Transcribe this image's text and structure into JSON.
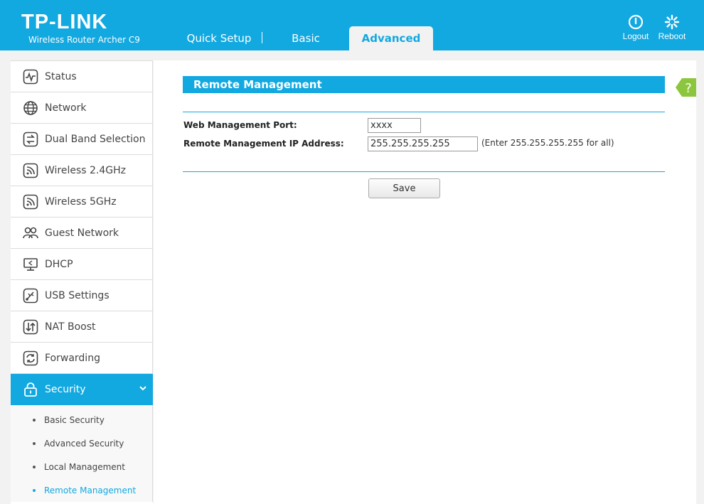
{
  "header": {
    "brand": "TP-LINK",
    "model": "Wireless Router Archer C9",
    "tabs": [
      {
        "label": "Quick Setup"
      },
      {
        "label": "Basic"
      },
      {
        "label": "Advanced"
      }
    ],
    "logout_label": "Logout",
    "reboot_label": "Reboot"
  },
  "sidebar": {
    "items": [
      {
        "label": "Status",
        "icon": "status-icon"
      },
      {
        "label": "Network",
        "icon": "globe-icon"
      },
      {
        "label": "Dual Band Selection",
        "icon": "dual-band-icon"
      },
      {
        "label": "Wireless 2.4GHz",
        "icon": "wireless-icon"
      },
      {
        "label": "Wireless 5GHz",
        "icon": "wireless-icon"
      },
      {
        "label": "Guest Network",
        "icon": "guest-icon"
      },
      {
        "label": "DHCP",
        "icon": "monitor-icon"
      },
      {
        "label": "USB Settings",
        "icon": "usb-icon"
      },
      {
        "label": "NAT Boost",
        "icon": "nat-icon"
      },
      {
        "label": "Forwarding",
        "icon": "forwarding-icon"
      },
      {
        "label": "Security",
        "icon": "lock-icon"
      }
    ],
    "security_sub": [
      {
        "label": "Basic Security"
      },
      {
        "label": "Advanced Security"
      },
      {
        "label": "Local Management"
      },
      {
        "label": "Remote Management"
      }
    ]
  },
  "main": {
    "title": "Remote Management",
    "help_label": "?",
    "port_label": "Web Management Port:",
    "port_value": "xxxx",
    "ip_label": "Remote Management IP Address:",
    "ip_value": "255.255.255.255",
    "ip_hint": "(Enter 255.255.255.255 for all)",
    "save_label": "Save"
  },
  "colors": {
    "accent": "#12a8e0",
    "help_green": "#8cc63e"
  }
}
